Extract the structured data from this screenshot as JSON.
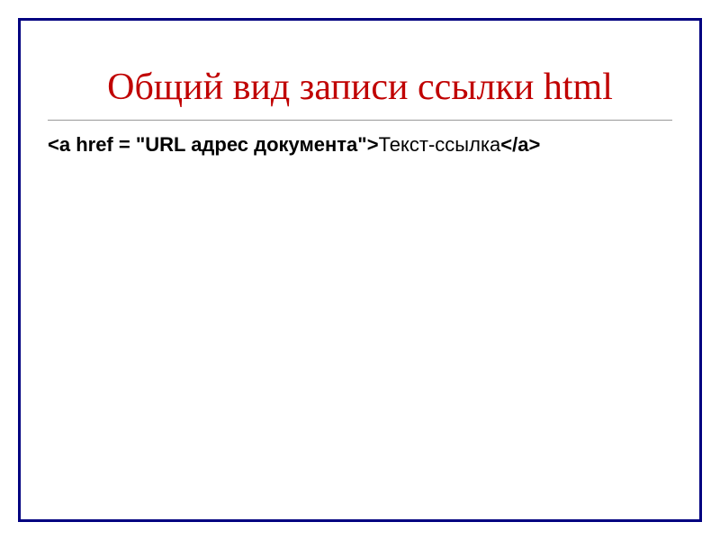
{
  "slide": {
    "title": "Общий вид записи ссылки html",
    "code": {
      "prefix_bold": "<a href = \"URL адрес документа\">",
      "middle_normal": "Текст-ссылка",
      "suffix_bold": "</a>"
    }
  }
}
